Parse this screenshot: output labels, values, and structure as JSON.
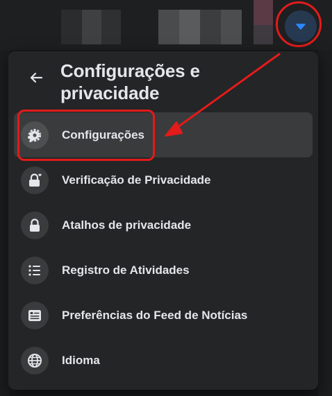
{
  "panel": {
    "title": "Configurações e privacidade",
    "back_icon": "arrow-left-icon"
  },
  "menu": {
    "items": [
      {
        "label": "Configurações",
        "icon": "gear-icon",
        "active": true
      },
      {
        "label": "Verificação de Privacidade",
        "icon": "lock-heart-icon",
        "active": false
      },
      {
        "label": "Atalhos de privacidade",
        "icon": "lock-icon",
        "active": false
      },
      {
        "label": "Registro de Atividades",
        "icon": "list-icon",
        "active": false
      },
      {
        "label": "Preferências do Feed de Notícias",
        "icon": "feed-icon",
        "active": false
      },
      {
        "label": "Idioma",
        "icon": "globe-icon",
        "active": false
      }
    ]
  },
  "header": {
    "account_dropdown_icon": "caret-down-icon"
  },
  "colors": {
    "panel_bg": "#242526",
    "text": "#e4e6eb",
    "accent": "#2d88ff",
    "highlight": "#e31b1b"
  }
}
